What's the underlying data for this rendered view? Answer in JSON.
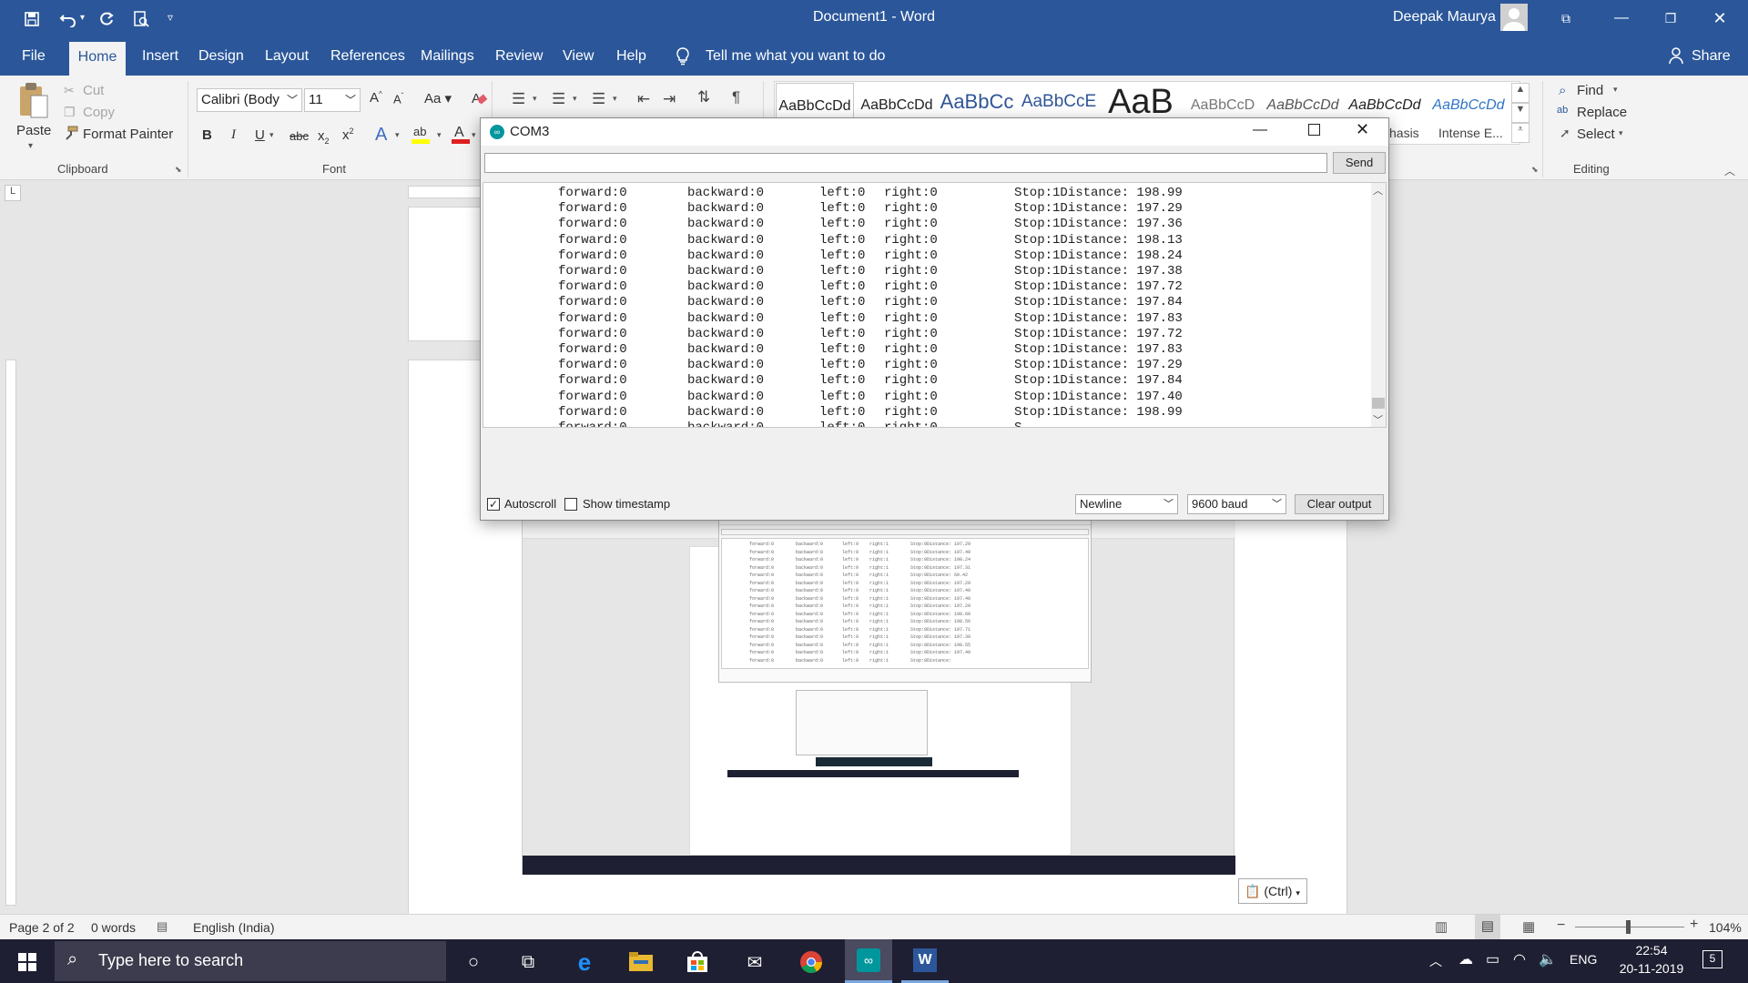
{
  "window": {
    "title": "Document1  -  Word",
    "user": "Deepak Maurya"
  },
  "tabs": [
    {
      "label": "File"
    },
    {
      "label": "Home"
    },
    {
      "label": "Insert"
    },
    {
      "label": "Design"
    },
    {
      "label": "Layout"
    },
    {
      "label": "References"
    },
    {
      "label": "Mailings"
    },
    {
      "label": "Review"
    },
    {
      "label": "View"
    },
    {
      "label": "Help"
    }
  ],
  "tell_me": "Tell me what you want to do",
  "share": "Share",
  "clipboard": {
    "paste": "Paste",
    "cut": "Cut",
    "copy": "Copy",
    "format_painter": "Format Painter",
    "label": "Clipboard"
  },
  "font": {
    "name": "Calibri (Body",
    "size": "11",
    "label": "Font"
  },
  "styles": [
    "AaBbCcDd",
    "AaBbCcDd",
    "AaBbCc",
    "AaBbCcE",
    "AaB",
    "AaBbCcD",
    "AaBbCcDd",
    "AaBbCcDd",
    "AaBbCcDd"
  ],
  "style_names": [
    "hasis",
    "Intense E..."
  ],
  "editing": {
    "find": "Find",
    "replace": "Replace",
    "select": "Select",
    "label": "Editing"
  },
  "serial_monitor": {
    "title": "COM3",
    "send": "Send",
    "input_value": "",
    "lines": [
      [
        "forward:0",
        "backward:0",
        "left:0",
        "right:0",
        "Stop:1Distance: 198.99"
      ],
      [
        "forward:0",
        "backward:0",
        "left:0",
        "right:0",
        "Stop:1Distance: 197.29"
      ],
      [
        "forward:0",
        "backward:0",
        "left:0",
        "right:0",
        "Stop:1Distance: 197.36"
      ],
      [
        "forward:0",
        "backward:0",
        "left:0",
        "right:0",
        "Stop:1Distance: 198.13"
      ],
      [
        "forward:0",
        "backward:0",
        "left:0",
        "right:0",
        "Stop:1Distance: 198.24"
      ],
      [
        "forward:0",
        "backward:0",
        "left:0",
        "right:0",
        "Stop:1Distance: 197.38"
      ],
      [
        "forward:0",
        "backward:0",
        "left:0",
        "right:0",
        "Stop:1Distance: 197.72"
      ],
      [
        "forward:0",
        "backward:0",
        "left:0",
        "right:0",
        "Stop:1Distance: 197.84"
      ],
      [
        "forward:0",
        "backward:0",
        "left:0",
        "right:0",
        "Stop:1Distance: 197.83"
      ],
      [
        "forward:0",
        "backward:0",
        "left:0",
        "right:0",
        "Stop:1Distance: 197.72"
      ],
      [
        "forward:0",
        "backward:0",
        "left:0",
        "right:0",
        "Stop:1Distance: 197.83"
      ],
      [
        "forward:0",
        "backward:0",
        "left:0",
        "right:0",
        "Stop:1Distance: 197.29"
      ],
      [
        "forward:0",
        "backward:0",
        "left:0",
        "right:0",
        "Stop:1Distance: 197.84"
      ],
      [
        "forward:0",
        "backward:0",
        "left:0",
        "right:0",
        "Stop:1Distance: 197.40"
      ],
      [
        "forward:0",
        "backward:0",
        "left:0",
        "right:0",
        "Stop:1Distance: 198.99"
      ],
      [
        "forward:0",
        "backward:0",
        "left:0",
        "right:0",
        "S"
      ]
    ],
    "autoscroll": "Autoscroll",
    "autoscroll_checked": true,
    "show_timestamp": "Show timestamp",
    "timestamp_checked": false,
    "line_ending": "Newline",
    "baud": "9600 baud",
    "clear": "Clear output"
  },
  "paste_options": "(Ctrl)",
  "status": {
    "page": "Page 2 of 2",
    "words": "0 words",
    "language": "English (India)",
    "zoom": "104%"
  },
  "taskbar": {
    "search_placeholder": "Type here to search",
    "lang": "ENG",
    "time": "22:54",
    "date": "20-11-2019",
    "notifications": "5"
  }
}
